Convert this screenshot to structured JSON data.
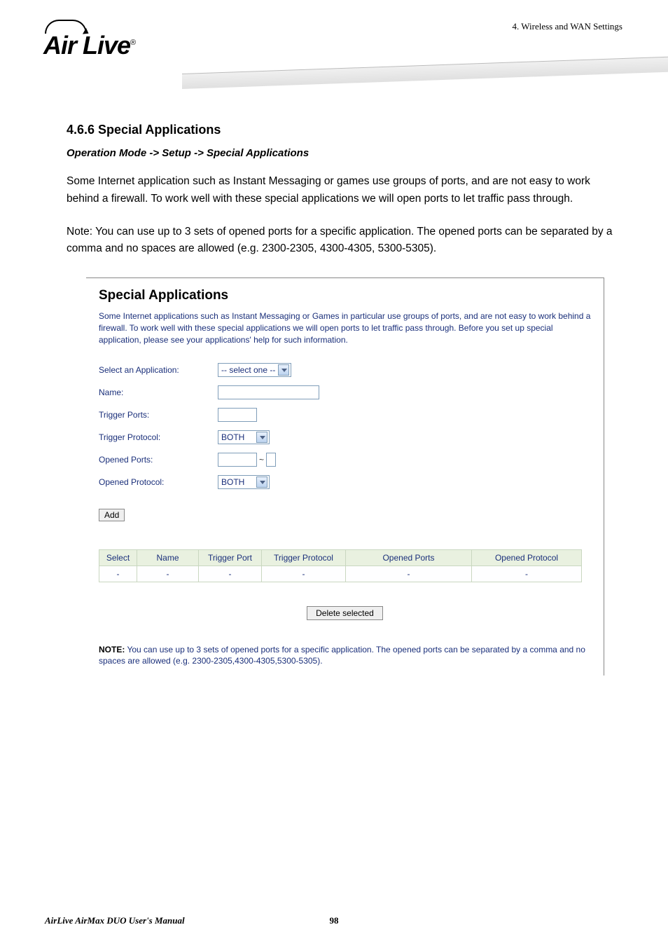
{
  "chapterLabel": "4. Wireless and WAN Settings",
  "logoText": "Air Live",
  "sectionHeading": "4.6.6 Special Applications",
  "subheading": "Operation Mode -> Setup -> Special Applications",
  "para1": "Some Internet application such as Instant Messaging or games use groups of ports, and are not easy to work behind a firewall. To work well with these special applications we will open ports to let traffic pass through.",
  "para2": "Note: You can use up to 3 sets of opened ports for a specific application. The opened ports can be separated by a comma and no spaces are allowed (e.g. 2300-2305, 4300-4305, 5300-5305).",
  "screenshot": {
    "title": "Special Applications",
    "desc": "Some Internet applications such as Instant Messaging or Games in particular use groups of ports, and are not easy to work behind a firewall. To work well with these special applications we will open ports to let traffic pass through. Before you set up special application, please see your applications' help for such information.",
    "labels": {
      "selectApp": "Select an Application:",
      "name": "Name:",
      "triggerPorts": "Trigger Ports:",
      "triggerProtocol": "Trigger Protocol:",
      "openedPorts": "Opened Ports:",
      "openedProtocol": "Opened Protocol:"
    },
    "values": {
      "selectAppOption": "-- select one --",
      "triggerProtocol": "BOTH",
      "openedProtocol": "BOTH"
    },
    "addLabel": "Add",
    "table": {
      "headers": [
        "Select",
        "Name",
        "Trigger Port",
        "Trigger Protocol",
        "Opened Ports",
        "Opened Protocol"
      ],
      "row": [
        "-",
        "-",
        "-",
        "-",
        "-",
        "-"
      ]
    },
    "deleteLabel": "Delete selected",
    "noteBold": "NOTE:",
    "noteText": " You can use up to 3 sets of opened ports for a specific application. The opened ports can be separated by a comma and no spaces are allowed (e.g. 2300-2305,4300-4305,5300-5305)."
  },
  "footer": {
    "left": "AirLive AirMax DUO User's Manual",
    "page": "98"
  },
  "chart_data": {
    "type": "table",
    "headers": [
      "Select",
      "Name",
      "Trigger Port",
      "Trigger Protocol",
      "Opened Ports",
      "Opened Protocol"
    ],
    "rows": [
      [
        "-",
        "-",
        "-",
        "-",
        "-",
        "-"
      ]
    ]
  }
}
